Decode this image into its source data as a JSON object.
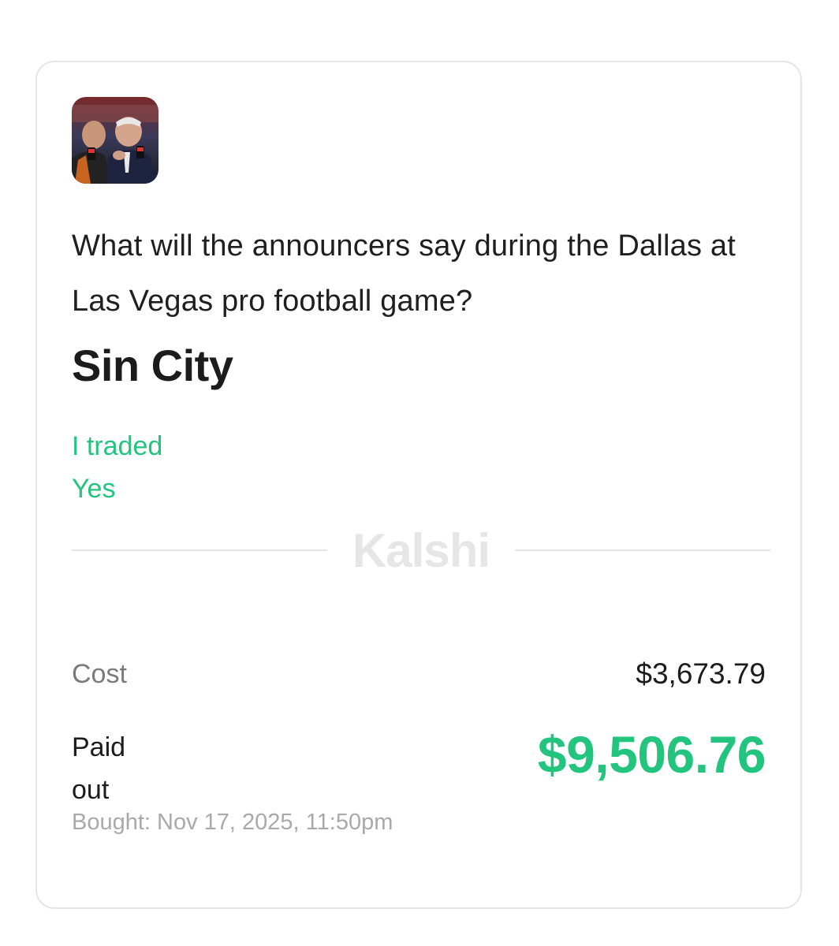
{
  "market": {
    "thumbnail_icon": "announcers-photo-icon",
    "question": "What will the announcers say during the Dallas at Las Vegas pro football game?",
    "answer": "Sin City",
    "trade_line1": "I traded",
    "trade_line2": "Yes"
  },
  "brand": {
    "watermark": "Kalshi"
  },
  "summary": {
    "cost_label": "Cost",
    "cost_value": "$3,673.79",
    "paid_label_line1": "Paid",
    "paid_label_line2": "out",
    "paid_value": "$9,506.76",
    "bought": "Bought: Nov 17, 2025, 11:50pm"
  },
  "colors": {
    "accent_green": "#22c47e",
    "text_dark": "#1c1c1c",
    "muted": "#7a7a7a",
    "watermark": "#e6e6e6"
  }
}
